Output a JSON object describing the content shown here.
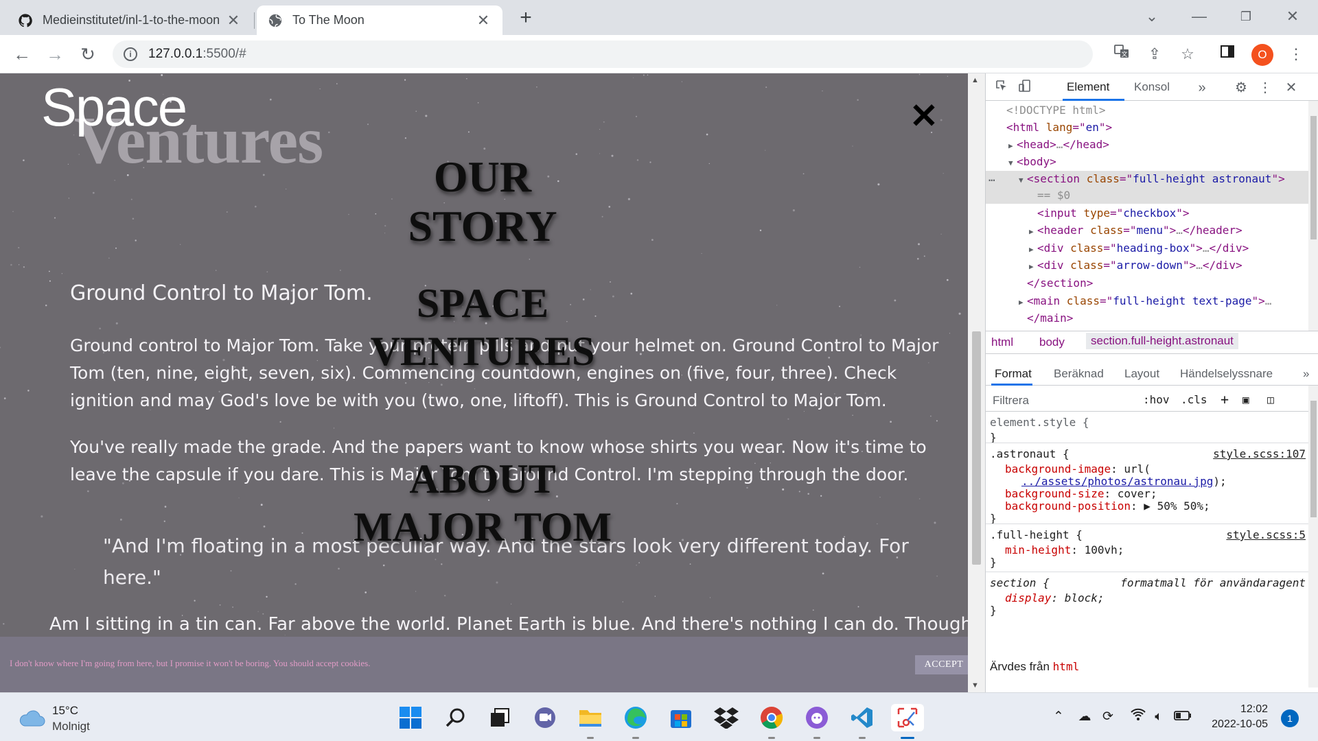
{
  "browser": {
    "tabs": [
      {
        "title": "Medieinstitutet/inl-1-to-the-moon",
        "active": false,
        "icon": "github-icon"
      },
      {
        "title": "To The Moon",
        "active": true,
        "icon": "globe-icon"
      }
    ],
    "url_host": "127.0.0.1",
    "url_rest": ":5500/#",
    "profile_initial": "O"
  },
  "page": {
    "brand_line1": "Space",
    "brand_line2": "Ventures",
    "menu_links": [
      "OUR STORY",
      "SPACE VENTURES",
      "ABOUT MAJOR TOM"
    ],
    "heading": "Ground Control to Major Tom.",
    "paragraphs": [
      "Ground control to Major Tom. Take your protein pills and put your helmet on. Ground Control to Major Tom (ten, nine, eight, seven, six). Commencing countdown, engines on (five, four, three). Check ignition and may God's love be with you (two, one, liftoff). This is Ground Control to Major Tom.",
      "You've really made the grade. And the papers want to know whose shirts you wear. Now it's time to leave the capsule if you dare. This is Major Tom to Ground Control. I'm stepping through the door."
    ],
    "quote": "\"And I'm floating in a most peculiar way. And the stars look very different today. For here.\"",
    "last_line": "Am I sitting in a tin can. Far above the world. Planet Earth is blue. And there's nothing I can do. Though I'm",
    "cookie_message": "I don't know where I'm going from here, but I promise it won't be boring. You should accept cookies.",
    "cookie_button": "ACCEPT"
  },
  "devtools": {
    "tabs": [
      "Element",
      "Konsol"
    ],
    "dom_lines": [
      {
        "indent": 0,
        "parts": [
          [
            "cm",
            "<!DOCTYPE html>"
          ]
        ]
      },
      {
        "indent": 0,
        "parts": [
          [
            "tg",
            "<html "
          ],
          [
            "an",
            "lang"
          ],
          [
            "tg",
            "=\""
          ],
          [
            "av",
            "en"
          ],
          [
            "tg",
            "\">"
          ]
        ]
      },
      {
        "indent": 1,
        "tri": "▶",
        "parts": [
          [
            "tg",
            "<head>"
          ],
          [
            "cm",
            "…"
          ],
          [
            "tg",
            "</head>"
          ]
        ]
      },
      {
        "indent": 1,
        "tri": "▼",
        "parts": [
          [
            "tg",
            "<body>"
          ]
        ]
      },
      {
        "indent": 2,
        "tri": "▼",
        "sel": true,
        "parts": [
          [
            "tg",
            "<section "
          ],
          [
            "an",
            "class"
          ],
          [
            "tg",
            "=\""
          ],
          [
            "av",
            "full-height astronaut"
          ],
          [
            "tg",
            "\">"
          ]
        ]
      },
      {
        "indent": 3,
        "sel": true,
        "parts": [
          [
            "cm",
            "== $0"
          ]
        ]
      },
      {
        "indent": 3,
        "parts": [
          [
            "tg",
            "<input "
          ],
          [
            "an",
            "type"
          ],
          [
            "tg",
            "=\""
          ],
          [
            "av",
            "checkbox"
          ],
          [
            "tg",
            "\">"
          ]
        ]
      },
      {
        "indent": 3,
        "tri": "▶",
        "parts": [
          [
            "tg",
            "<header "
          ],
          [
            "an",
            "class"
          ],
          [
            "tg",
            "=\""
          ],
          [
            "av",
            "menu"
          ],
          [
            "tg",
            "\">"
          ],
          [
            "cm",
            "…"
          ],
          [
            "tg",
            "</header>"
          ]
        ]
      },
      {
        "indent": 3,
        "tri": "▶",
        "parts": [
          [
            "tg",
            "<div "
          ],
          [
            "an",
            "class"
          ],
          [
            "tg",
            "=\""
          ],
          [
            "av",
            "heading-box"
          ],
          [
            "tg",
            "\">"
          ],
          [
            "cm",
            "…"
          ],
          [
            "tg",
            "</div>"
          ]
        ]
      },
      {
        "indent": 3,
        "tri": "▶",
        "parts": [
          [
            "tg",
            "<div "
          ],
          [
            "an",
            "class"
          ],
          [
            "tg",
            "=\""
          ],
          [
            "av",
            "arrow-down"
          ],
          [
            "tg",
            "\">"
          ],
          [
            "cm",
            "…"
          ],
          [
            "tg",
            "</div>"
          ]
        ]
      },
      {
        "indent": 2,
        "parts": [
          [
            "tg",
            "</section>"
          ]
        ]
      },
      {
        "indent": 2,
        "tri": "▶",
        "parts": [
          [
            "tg",
            "<main "
          ],
          [
            "an",
            "class"
          ],
          [
            "tg",
            "=\""
          ],
          [
            "av",
            "full-height text-page"
          ],
          [
            "tg",
            "\">"
          ],
          [
            "cm",
            "…"
          ]
        ]
      },
      {
        "indent": 2,
        "parts": [
          [
            "tg",
            "</main>"
          ]
        ]
      }
    ],
    "breadcrumbs": [
      "html",
      "body",
      "section.full-height.astronaut"
    ],
    "style_tabs": [
      "Format",
      "Beräknad",
      "Layout",
      "Händelselyssnare"
    ],
    "filter_placeholder": "Filtrera",
    "hov": ":hov",
    "cls": ".cls",
    "rules": [
      {
        "selector": "element.style {",
        "source": "",
        "props": [],
        "close": "}"
      },
      {
        "selector": ".astronaut {",
        "source": "style.scss:107",
        "props": [
          {
            "name": "background-image",
            "value": "url(",
            "link": "../assets/photos/astronau.jpg",
            "after": ");"
          },
          {
            "name": "background-size",
            "value": "cover;"
          },
          {
            "name": "background-position",
            "value": "▶ 50% 50%;"
          }
        ],
        "close": "}"
      },
      {
        "selector": ".full-height {",
        "source": "style.scss:5",
        "props": [
          {
            "name": "min-height",
            "value": "100vh;"
          }
        ],
        "close": "}"
      },
      {
        "selector": "section {",
        "source": "formatmall för användaragent",
        "ua": true,
        "props": [
          {
            "name": "display",
            "value": "block;"
          }
        ],
        "close": "}"
      }
    ],
    "inherited_label": "Ärvdes från",
    "inherited_from": "html"
  },
  "taskbar": {
    "temperature": "15°C",
    "condition": "Molnigt",
    "time": "12:02",
    "date": "2022-10-05",
    "notifications": "1"
  },
  "colors": {
    "page_overlay": "#6d6a6f",
    "cookie_bar": "#7a7685",
    "cookie_text": "#e39cc7",
    "accent": "#1a73e8"
  }
}
